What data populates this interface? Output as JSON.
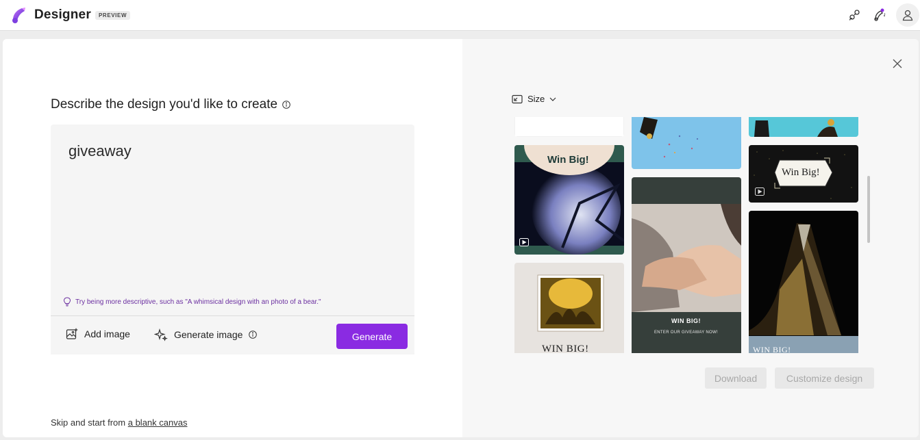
{
  "header": {
    "app_name": "Designer",
    "badge": "PREVIEW"
  },
  "left": {
    "heading": "Describe the design you'd like to create",
    "prompt_value": "giveaway",
    "hint": "Try being more descriptive, such as \"A whimsical design with an photo of a bear.\"",
    "add_image_label": "Add image",
    "generate_image_label": "Generate image",
    "generate_button": "Generate",
    "skip_prefix": "Skip and start from",
    "skip_link": "a blank canvas"
  },
  "right": {
    "size_label": "Size",
    "tiles": {
      "t1_text": "Win Big!",
      "t2_text": "Win Big!",
      "t3_title": "WIN BIG!",
      "t3_sub": "ENTER OUR GIVEAWAY NOW!",
      "t4_text": "WIN BIG!",
      "t5_text": "WIN BIG!"
    },
    "download_button": "Download",
    "customize_button": "Customize design"
  },
  "colors": {
    "accent": "#8a2be2",
    "hint": "#6b2fa0"
  },
  "icons": [
    "logo-icon",
    "share-icon",
    "magic-icon",
    "account-icon",
    "info-icon",
    "lightbulb-icon",
    "add-image-icon",
    "sparkle-icon",
    "close-icon",
    "resize-icon",
    "chevron-down-icon",
    "play-icon"
  ]
}
